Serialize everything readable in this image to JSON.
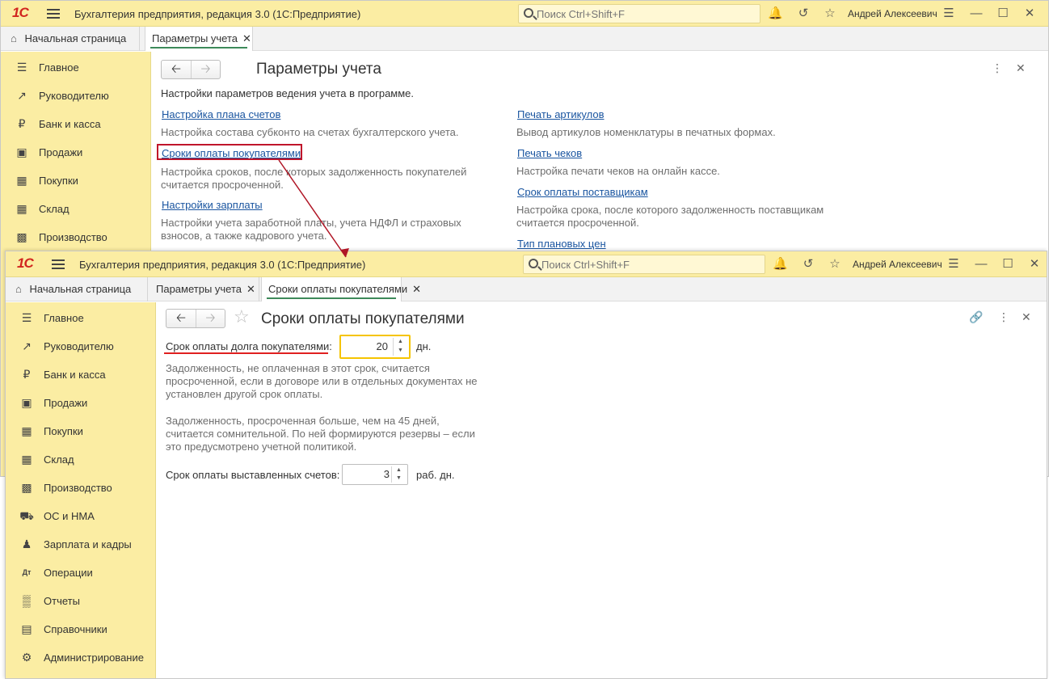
{
  "app": {
    "title": "Бухгалтерия предприятия, редакция 3.0  (1С:Предприятие)",
    "logo": "1С",
    "search_placeholder": "Поиск Ctrl+Shift+F",
    "user": "Андрей Алексеевич"
  },
  "sidebar": [
    {
      "label": "Главное",
      "icon": "menu-lines-icon"
    },
    {
      "label": "Руководителю",
      "icon": "trend-icon"
    },
    {
      "label": "Банк и касса",
      "icon": "ruble-icon"
    },
    {
      "label": "Продажи",
      "icon": "bag-icon"
    },
    {
      "label": "Покупки",
      "icon": "cart-icon"
    },
    {
      "label": "Склад",
      "icon": "grid-icon"
    },
    {
      "label": "Производство",
      "icon": "factory-icon"
    },
    {
      "label": "ОС и НМА",
      "icon": "truck-icon"
    },
    {
      "label": "Зарплата и кадры",
      "icon": "person-icon"
    },
    {
      "label": "Операции",
      "icon": "dt-kt-icon"
    },
    {
      "label": "Отчеты",
      "icon": "bar-chart-icon"
    },
    {
      "label": "Справочники",
      "icon": "book-icon"
    },
    {
      "label": "Администрирование",
      "icon": "gear-icon"
    }
  ],
  "win1": {
    "tabs": [
      "Начальная страница",
      "Параметры учета"
    ],
    "title": "Параметры учета",
    "intro": "Настройки параметров ведения учета в программе.",
    "left": [
      {
        "link": "Настройка плана счетов",
        "desc": "Настройка состава субконто на счетах бухгалтерского учета."
      },
      {
        "link": "Сроки оплаты покупателями",
        "desc": "Настройка сроков, после которых задолженность покупателей считается просроченной."
      },
      {
        "link": "Настройки зарплаты",
        "desc": "Настройки учета заработной платы, учета НДФЛ и страховых взносов, а также кадрового учета."
      }
    ],
    "right": [
      {
        "link": "Печать артикулов",
        "desc": "Вывод артикулов номенклатуры в печатных формах."
      },
      {
        "link": "Печать чеков",
        "desc": "Настройка печати чеков на онлайн кассе."
      },
      {
        "link": "Срок оплаты поставщикам",
        "desc": "Настройка срока, после которого задолженность поставщикам считается просроченной."
      },
      {
        "link": "Тип плановых цен",
        "desc": ""
      }
    ]
  },
  "win2": {
    "tabs": [
      "Начальная страница",
      "Параметры учета",
      "Сроки оплаты покупателями"
    ],
    "title": "Сроки оплаты покупателями",
    "debt_label": "Срок оплаты долга покупателями:",
    "debt_value": "20",
    "debt_unit": "дн.",
    "note1": "Задолженность, не оплаченная в этот срок, считается просроченной, если в договоре или в отдельных документах не установлен другой срок оплаты.",
    "note2": "Задолженность, просроченная больше, чем на 45 дней, считается сомнительной. По ней формируются резервы – если это предусмотрено учетной политикой.",
    "invoice_label": "Срок оплаты выставленных счетов:",
    "invoice_value": "3",
    "invoice_unit": "раб. дн."
  },
  "colors": {
    "titlebar": "#fbeda3",
    "link": "#1a55a0",
    "highlight": "#c0152b",
    "focus": "#f5c400"
  }
}
